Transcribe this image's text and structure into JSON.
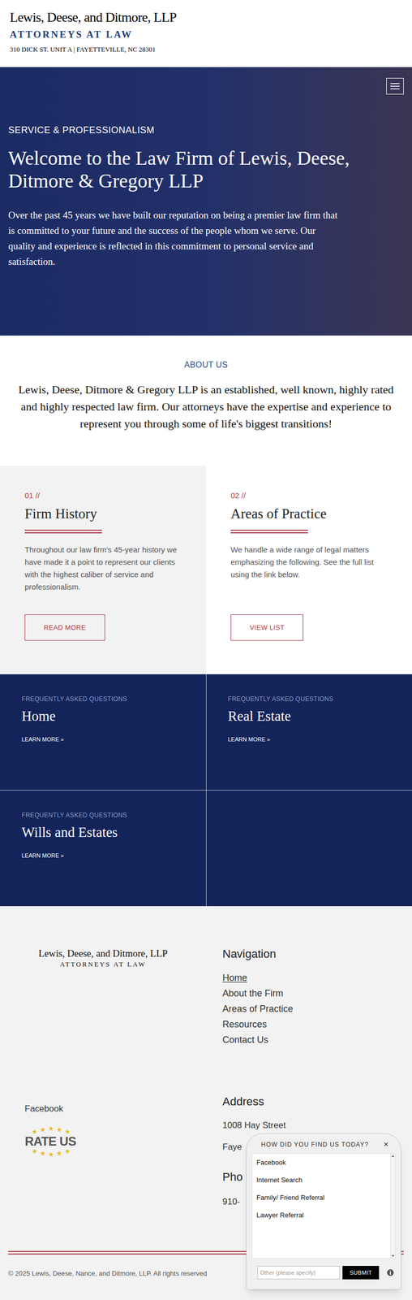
{
  "header": {
    "firm_name": "Lewis, Deese, and Ditmore, LLP",
    "tagline": "ATTORNEYS AT LAW",
    "address": "310 DICK ST. UNIT A | FAYETTEVILLE, NC 28301"
  },
  "hero": {
    "eyebrow": "SERVICE & PROFESSIONALISM",
    "title": "Welcome to the Law Firm of Lewis, Deese, Ditmore & Gregory LLP",
    "body": "Over the past 45 years we have built our reputation on being a premier law firm that is committed to your future and the success of the people whom we serve. Our quality and experience is reflected in this commitment to personal service and satisfaction."
  },
  "about": {
    "label": "ABOUT US",
    "body": "Lewis, Deese, Ditmore & Gregory LLP is an established, well known, highly rated and highly respected law firm. Our attorneys have the expertise and experience to represent you through some of life's biggest transitions!"
  },
  "cards": [
    {
      "number": "01 //",
      "title": "Firm History",
      "body": "Throughout our law firm's 45-year history we have made it a point to represent our clients with the highest caliber of service and professionalism.",
      "button": "READ MORE"
    },
    {
      "number": "02 //",
      "title": "Areas of Practice",
      "body": "We handle a wide range of legal matters emphasizing the following. See the full list using the link below.",
      "button": "VIEW LIST"
    }
  ],
  "faq_tiles": [
    {
      "eyebrow": "FREQUENTLY ASKED QUESTIONS",
      "title": "Home",
      "link": "LEARN MORE »"
    },
    {
      "eyebrow": "FREQUENTLY ASKED QUESTIONS",
      "title": "Real Estate",
      "link": "LEARN MORE »"
    },
    {
      "eyebrow": "FREQUENTLY ASKED QUESTIONS",
      "title": "Wills and Estates",
      "link": "LEARN MORE »"
    }
  ],
  "footer": {
    "logo_name": "Lewis, Deese, and Ditmore, LLP",
    "logo_tagline": "ATTORNEYS AT LAW",
    "nav_title": "Navigation",
    "nav_links": [
      {
        "label": "Home",
        "selected": true
      },
      {
        "label": "About the Firm",
        "selected": false
      },
      {
        "label": "Areas of Practice",
        "selected": false
      },
      {
        "label": "Resources",
        "selected": false
      },
      {
        "label": "Contact Us",
        "selected": false
      }
    ],
    "social": "Facebook",
    "rate_badge": "RATE US",
    "address_title": "Address",
    "address_lines": [
      "1008 Hay Street",
      "Faye"
    ],
    "phone_title": "Pho",
    "phone": "910-",
    "copyright": "© 2025 Lewis, Deese, Nance, and Ditmore, LLP. All rights reserved"
  },
  "popup": {
    "title": "HOW DID YOU FIND US TODAY?",
    "close": "×",
    "options": [
      "Facebook",
      "Internet Search",
      "Family/ Friend Referral",
      "Lawyer Referral"
    ],
    "other_placeholder": "Other (please specify)",
    "submit": "SUBMIT"
  }
}
